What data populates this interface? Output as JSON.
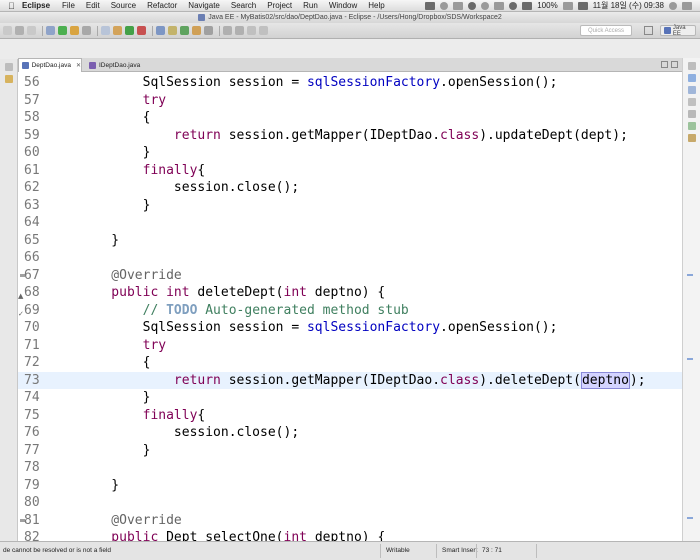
{
  "menubar": {
    "app_name": "Eclipse",
    "items": [
      "File",
      "Edit",
      "Source",
      "Refactor",
      "Navigate",
      "Search",
      "Project",
      "Run",
      "Window",
      "Help"
    ],
    "battery": "100%",
    "datetime": "11월 18일 (수)  09:38"
  },
  "window": {
    "title": "Java EE - MyBatis02/src/dao/DeptDao.java - Eclipse - /Users/Hong/Dropbox/SDS/Workspace2"
  },
  "toolbar": {
    "quick_access_placeholder": "Quick Access",
    "perspective_label": "Java EE"
  },
  "tabs": [
    {
      "label": "DeptDao.java",
      "active": true
    },
    {
      "label": "IDeptDao.java",
      "active": false
    }
  ],
  "editor": {
    "lines": [
      {
        "n": "56",
        "segs": [
          [
            "p",
            "        SqlSession session = "
          ],
          [
            "f",
            "sqlSessionFactory"
          ],
          [
            "p",
            ".openSession();"
          ]
        ]
      },
      {
        "n": "57",
        "segs": [
          [
            "k",
            "        try"
          ]
        ]
      },
      {
        "n": "58",
        "segs": [
          [
            "p",
            "        {"
          ]
        ]
      },
      {
        "n": "59",
        "segs": [
          [
            "k",
            "            return"
          ],
          [
            "p",
            " session.getMapper(IDeptDao."
          ],
          [
            "k",
            "class"
          ],
          [
            "p",
            ").updateDept(dept);"
          ]
        ]
      },
      {
        "n": "60",
        "segs": [
          [
            "p",
            "        }"
          ]
        ]
      },
      {
        "n": "61",
        "segs": [
          [
            "k",
            "        finally"
          ],
          [
            "p",
            "{"
          ]
        ]
      },
      {
        "n": "62",
        "segs": [
          [
            "p",
            "            session.close();"
          ]
        ]
      },
      {
        "n": "63",
        "segs": [
          [
            "p",
            "        }"
          ]
        ]
      },
      {
        "n": "64",
        "segs": [
          [
            "p",
            ""
          ]
        ]
      },
      {
        "n": "65",
        "segs": [
          [
            "p",
            "    }"
          ]
        ]
      },
      {
        "n": "66",
        "segs": [
          [
            "p",
            ""
          ]
        ]
      },
      {
        "n": "67",
        "segs": [
          [
            "a",
            "    @Override"
          ]
        ],
        "fold": true
      },
      {
        "n": "68",
        "segs": [
          [
            "k",
            "    public int"
          ],
          [
            "p",
            " deleteDept("
          ],
          [
            "k",
            "int"
          ],
          [
            "p",
            " deptno) {"
          ]
        ],
        "marker": "▲"
      },
      {
        "n": "69",
        "segs": [
          [
            "c",
            "        // "
          ],
          [
            "t",
            "TODO"
          ],
          [
            "c",
            " Auto-generated method stub"
          ]
        ],
        "marker": "✓"
      },
      {
        "n": "70",
        "segs": [
          [
            "p",
            "        SqlSession session = "
          ],
          [
            "f",
            "sqlSessionFactory"
          ],
          [
            "p",
            ".openSession();"
          ]
        ]
      },
      {
        "n": "71",
        "segs": [
          [
            "k",
            "        try"
          ]
        ]
      },
      {
        "n": "72",
        "segs": [
          [
            "p",
            "        {"
          ]
        ]
      },
      {
        "n": "73",
        "segs": [
          [
            "k",
            "            return"
          ],
          [
            "p",
            " session.getMapper(IDeptDao."
          ],
          [
            "k",
            "class"
          ],
          [
            "p",
            ").deleteDept("
          ],
          [
            "s",
            "deptno"
          ],
          [
            "p",
            ");"
          ]
        ],
        "current": true
      },
      {
        "n": "74",
        "segs": [
          [
            "p",
            "        }"
          ]
        ]
      },
      {
        "n": "75",
        "segs": [
          [
            "k",
            "        finally"
          ],
          [
            "p",
            "{"
          ]
        ]
      },
      {
        "n": "76",
        "segs": [
          [
            "p",
            "            session.close();"
          ]
        ]
      },
      {
        "n": "77",
        "segs": [
          [
            "p",
            "        }"
          ]
        ]
      },
      {
        "n": "78",
        "segs": [
          [
            "p",
            ""
          ]
        ]
      },
      {
        "n": "79",
        "segs": [
          [
            "p",
            "    }"
          ]
        ]
      },
      {
        "n": "80",
        "segs": [
          [
            "p",
            ""
          ]
        ]
      },
      {
        "n": "81",
        "segs": [
          [
            "a",
            "    @Override"
          ]
        ],
        "fold": true
      },
      {
        "n": "82",
        "segs": [
          [
            "k",
            "    public"
          ],
          [
            "p",
            " Dept selectOne("
          ],
          [
            "k",
            "int"
          ],
          [
            "p",
            " deptno) {"
          ]
        ]
      }
    ]
  },
  "statusbar": {
    "message": "de cannot be resolved or is not a field",
    "writable": "Writable",
    "insert_mode": "Smart Insert",
    "position": "73 : 71"
  }
}
